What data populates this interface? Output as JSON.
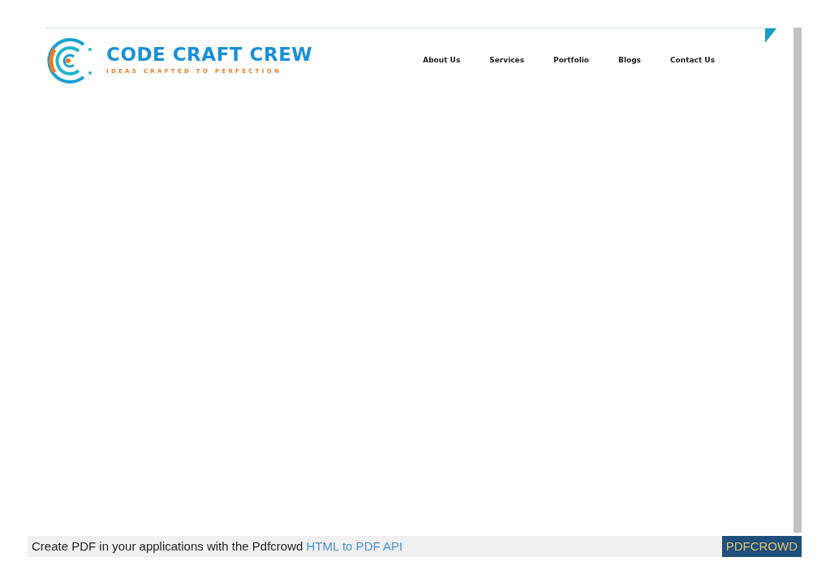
{
  "header": {
    "logo": {
      "title": "CODE CRAFT CREW",
      "tagline": "IDEAS CRAFTED TO PERFECTION"
    },
    "nav": [
      {
        "label": "About Us"
      },
      {
        "label": "Services"
      },
      {
        "label": "Portfolio"
      },
      {
        "label": "Blogs"
      },
      {
        "label": "Contact Us"
      }
    ]
  },
  "footer": {
    "text": "Create PDF in your applications with the Pdfcrowd",
    "link": "HTML to PDF API",
    "button": "PDFCROWD"
  }
}
